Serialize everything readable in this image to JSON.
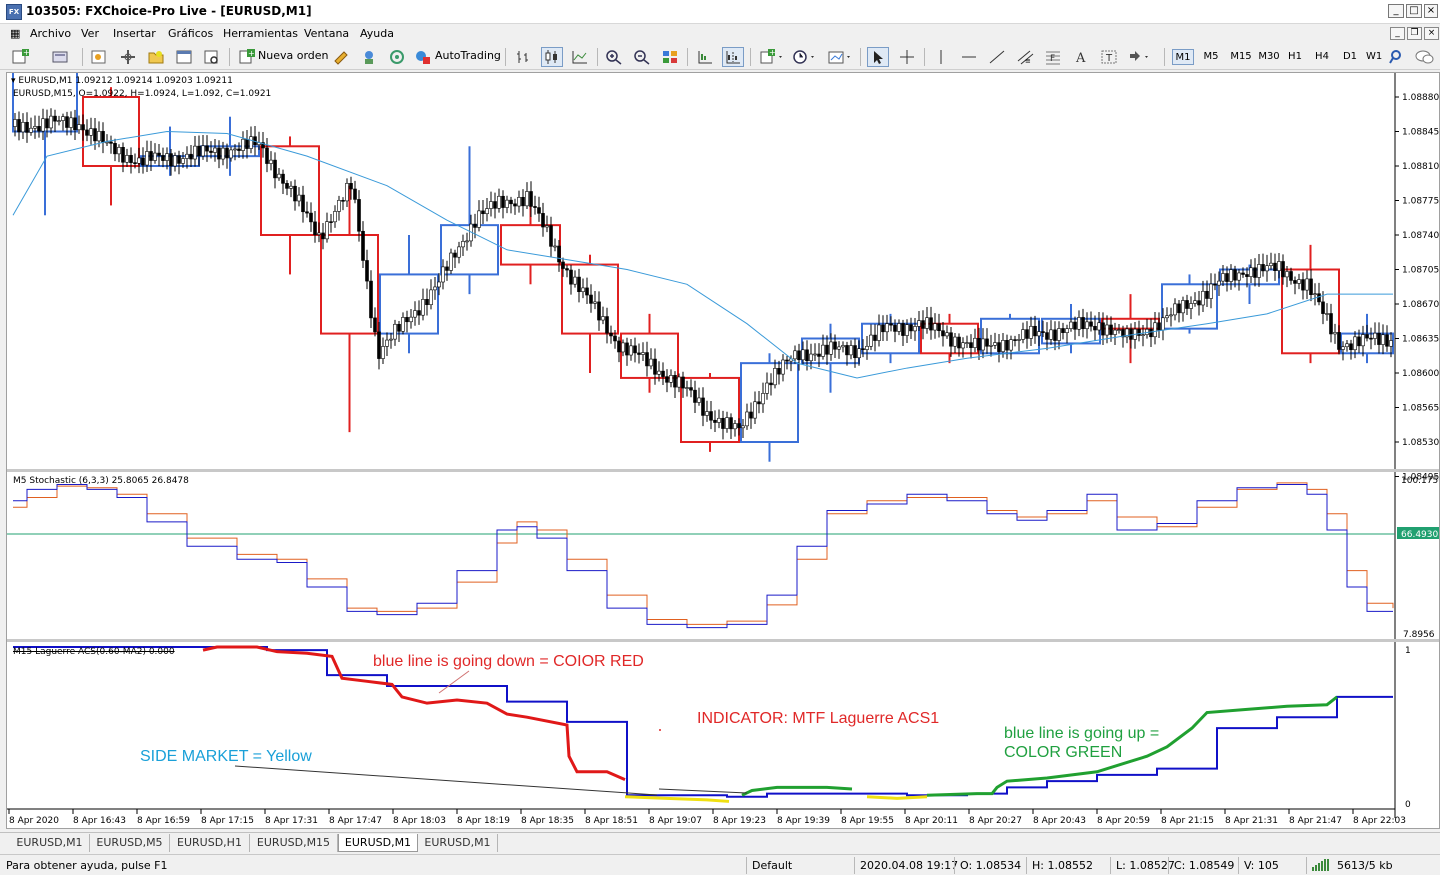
{
  "window": {
    "title": "103505: FXChoice-Pro Live - [EURUSD,M1]",
    "icon": "FX"
  },
  "menu": [
    "Archivo",
    "Ver",
    "Insertar",
    "Gráficos",
    "Herramientas",
    "Ventana",
    "Ayuda"
  ],
  "toolbar": {
    "new_order": "Nueva orden",
    "autotrading": "AutoTrading",
    "timeframes": [
      "M1",
      "M5",
      "M15",
      "M30",
      "H1",
      "H4",
      "D1",
      "W1"
    ],
    "active_timeframe": "M1"
  },
  "chart": {
    "info_line1": "EURUSD,M1  1.09212 1.09214 1.09203 1.09211",
    "info_line2": "EURUSD,M15,  O=1.0922,  H=1.0924,  L=1.092,  C=1.0921",
    "price_axis": [
      "1.08880",
      "1.08845",
      "1.08810",
      "1.08775",
      "1.08740",
      "1.08705",
      "1.08670",
      "1.08635",
      "1.08600",
      "1.08565",
      "1.08530",
      "1.08495"
    ],
    "stoch_label": "M5 Stochastic (6,3,3) 25.8065 26.8478",
    "stoch_axis_top": "100.1756",
    "stoch_axis_level": "66.4930",
    "stoch_axis_bottom": "7.8956",
    "laguerre_label": "M15 Laguerre ACS(0.60-MA2) 0.000",
    "laguerre_axis_top": "1",
    "laguerre_axis_bottom": "0",
    "time_axis": [
      "8 Apr 2020",
      "8 Apr 16:43",
      "8 Apr 16:59",
      "8 Apr 17:15",
      "8 Apr 17:31",
      "8 Apr 17:47",
      "8 Apr 18:03",
      "8 Apr 18:19",
      "8 Apr 18:35",
      "8 Apr 18:51",
      "8 Apr 19:07",
      "8 Apr 19:23",
      "8 Apr 19:39",
      "8 Apr 19:55",
      "8 Apr 20:11",
      "8 Apr 20:27",
      "8 Apr 20:43",
      "8 Apr 20:59",
      "8 Apr 21:15",
      "8 Apr 21:31",
      "8 Apr 21:47",
      "8 Apr 22:03"
    ],
    "annotations": {
      "red": "blue line is going down = COIOR RED",
      "indicator": "INDICATOR: MTF Laguerre ACS1",
      "side": "SIDE MARKET = Yellow",
      "green_line1": "blue line is going up =",
      "green_line2": "COLOR GREEN"
    },
    "colors": {
      "bear_box": "#e02020",
      "bull_box": "#3a6fd8",
      "ma": "#3a9ad9",
      "stoch_main": "#1a1ac8",
      "stoch_signal": "#e06020",
      "lag_blue": "#1010c8",
      "lag_red": "#e01818",
      "lag_yellow": "#f0e010",
      "lag_green": "#20a030",
      "annot_red": "#e02828",
      "annot_blue": "#1aa0d8",
      "annot_green": "#20a040"
    }
  },
  "tabs": [
    "EURUSD,M1",
    "EURUSD,M5",
    "EURUSD,H1",
    "EURUSD,M15",
    "EURUSD,M1",
    "EURUSD,M1"
  ],
  "active_tab": 4,
  "status": {
    "help": "Para obtener ayuda, pulse F1",
    "profile": "Default",
    "datetime": "2020.04.08 19:17",
    "open": "O: 1.08534",
    "high": "H: 1.08552",
    "low": "L: 1.08527",
    "close": "C: 1.08549",
    "volume": "V: 105",
    "traffic": "5613/5 kb"
  }
}
